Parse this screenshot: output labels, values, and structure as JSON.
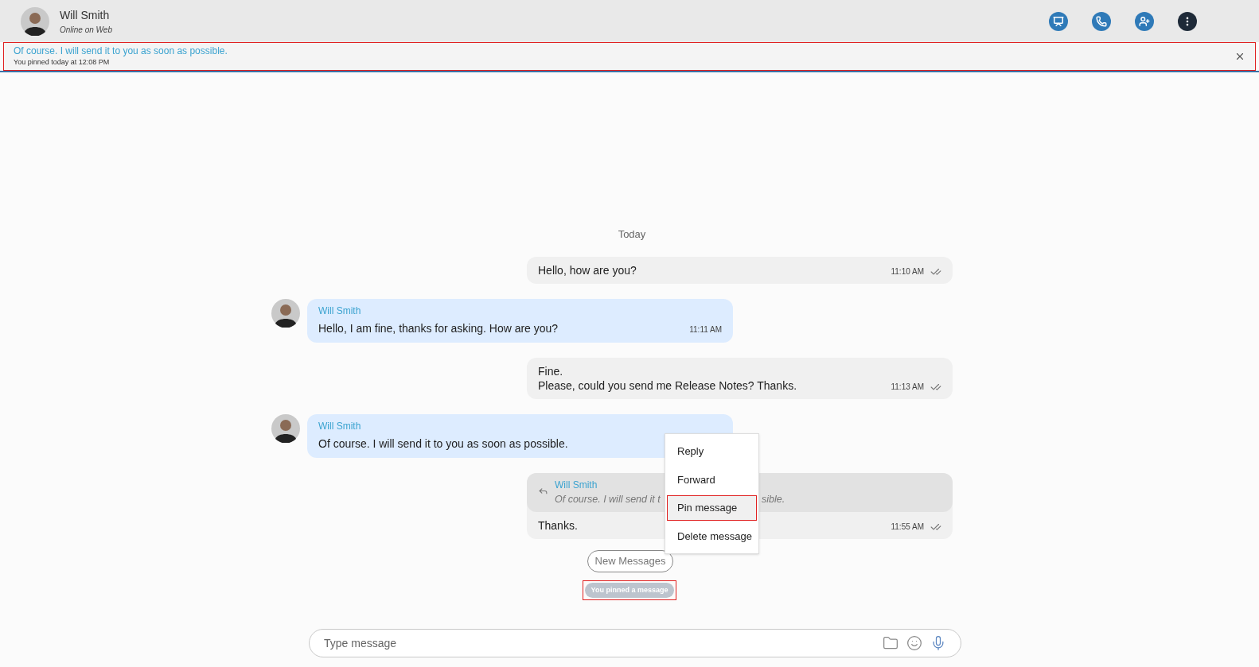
{
  "header": {
    "name": "Will Smith",
    "status": "Online on Web",
    "actions": [
      {
        "kind": "screen"
      },
      {
        "kind": "call"
      },
      {
        "kind": "add-user"
      },
      {
        "kind": "more"
      }
    ]
  },
  "pinned": {
    "text": "Of course. I will send it to you as soon as possible.",
    "meta": "You pinned today at 12:08 PM",
    "highlighted": true
  },
  "date_separator": "Today",
  "messages": [
    {
      "kind": "outgoing",
      "lines": [
        "Hello, how are you?"
      ],
      "time": "11:10 AM",
      "read": true
    },
    {
      "kind": "incoming",
      "sender": "Will Smith",
      "lines": [
        "Hello, I am fine, thanks for asking. How are you?"
      ],
      "time": "11:11 AM"
    },
    {
      "kind": "outgoing",
      "lines": [
        "Fine.",
        "Please, could you send me Release Notes? Thanks."
      ],
      "time": "11:13 AM",
      "read": true
    },
    {
      "kind": "incoming",
      "sender": "Will Smith",
      "lines": [
        "Of course. I will send it to you as soon as possible."
      ],
      "context_menu": [
        {
          "label": "Reply",
          "highlighted": false
        },
        {
          "label": "Forward",
          "highlighted": false
        },
        {
          "label": "Pin message",
          "highlighted": true
        },
        {
          "label": "Delete message",
          "highlighted": false
        }
      ]
    },
    {
      "kind": "outgoing",
      "quote": {
        "sender": "Will Smith",
        "text_before": "Of course. I will send it t",
        "text_after": "sible."
      },
      "lines": [
        "Thanks."
      ],
      "time": "11:55 AM",
      "read": true
    }
  ],
  "new_messages_button": "New Messages",
  "system_notice": {
    "text": "You pinned a message",
    "highlighted": true
  },
  "composer": {
    "placeholder": "Type message"
  }
}
